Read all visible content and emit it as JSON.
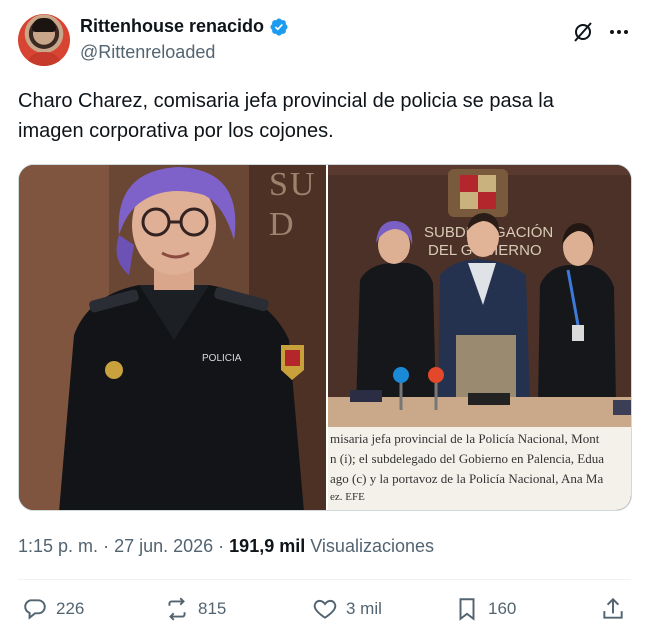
{
  "author": {
    "display_name": "Rittenhouse renacido",
    "handle": "@Rittenreloaded",
    "verified": true,
    "accent_color": "#1d9bf0"
  },
  "tweet": {
    "text_line1": "Charo Charez, comisaria jefa provincial de policia se pasa la",
    "text_line2": "imagen corporativa por los cojones."
  },
  "media": {
    "left_photo_wall_text": "SU\nD",
    "right_photo_wall_text": "SUBDELEGACIÓN DEL GOBIERNO",
    "caption": [
      "misaria jefa provincial de la Policía Nacional, Mont",
      "n (i); el subdelegado del Gobierno en Palencia, Edua",
      "ago (c) y la portavoz de la Policía Nacional, Ana Ma",
      "ez. EFE"
    ]
  },
  "meta": {
    "time": "1:15 p. m.",
    "date": "27 jun. 2026",
    "views_count": "191,9 mil",
    "views_label": "Visualizaciones"
  },
  "actions": {
    "replies": "226",
    "reposts": "815",
    "likes": "3 mil",
    "bookmarks": "160"
  },
  "icons": [
    "verified-badge-icon",
    "grok-icon",
    "more-icon",
    "reply-icon",
    "repost-icon",
    "like-icon",
    "bookmark-icon",
    "share-icon"
  ]
}
